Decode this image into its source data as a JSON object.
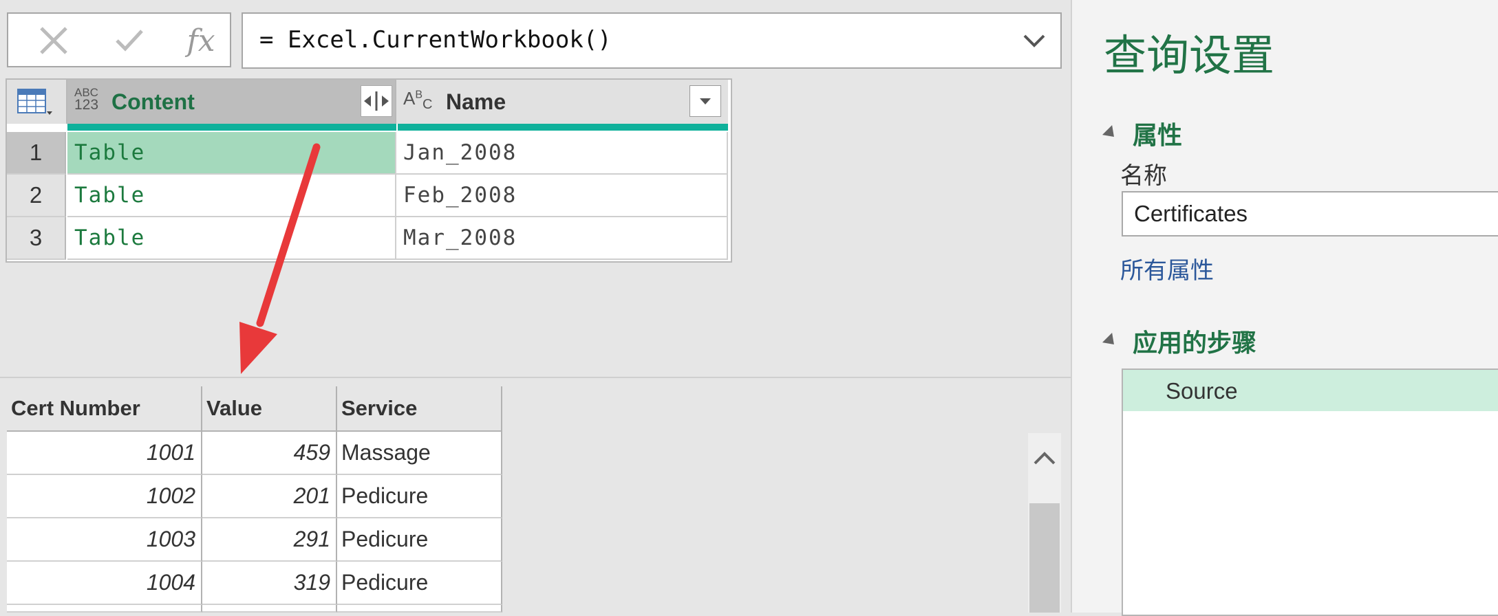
{
  "formula_bar": {
    "cancel_icon": "x-icon",
    "confirm_icon": "check-icon",
    "fx_label": "fx",
    "formula": "= Excel.CurrentWorkbook()",
    "expand_icon": "chevron-down-icon"
  },
  "grid": {
    "columns": [
      {
        "type_label_top": "ABC",
        "type_label_bottom": "123",
        "name": "Content"
      },
      {
        "type_label_top": "A",
        "type_label_sup": "B",
        "type_label_sub": "C",
        "name": "Name"
      }
    ],
    "rows": [
      {
        "num": "1",
        "content": "Table",
        "name": "Jan_2008"
      },
      {
        "num": "2",
        "content": "Table",
        "name": "Feb_2008"
      },
      {
        "num": "3",
        "content": "Table",
        "name": "Mar_2008"
      }
    ]
  },
  "preview": {
    "headers": [
      "Cert Number",
      "Value",
      "Service"
    ],
    "rows": [
      [
        "1001",
        "459",
        "Massage"
      ],
      [
        "1002",
        "201",
        "Pedicure"
      ],
      [
        "1003",
        "291",
        "Pedicure"
      ],
      [
        "1004",
        "319",
        "Pedicure"
      ]
    ]
  },
  "query_settings": {
    "title": "查询设置",
    "properties_header": "属性",
    "name_label": "名称",
    "name_value": "Certificates",
    "all_properties_link": "所有属性",
    "applied_steps_header": "应用的步骤",
    "steps": [
      "Source"
    ]
  },
  "colors": {
    "accent_green": "#217346",
    "teal": "#0fb19b",
    "selected_cell": "#a4d9bc",
    "arrow_red": "#e8393a"
  }
}
